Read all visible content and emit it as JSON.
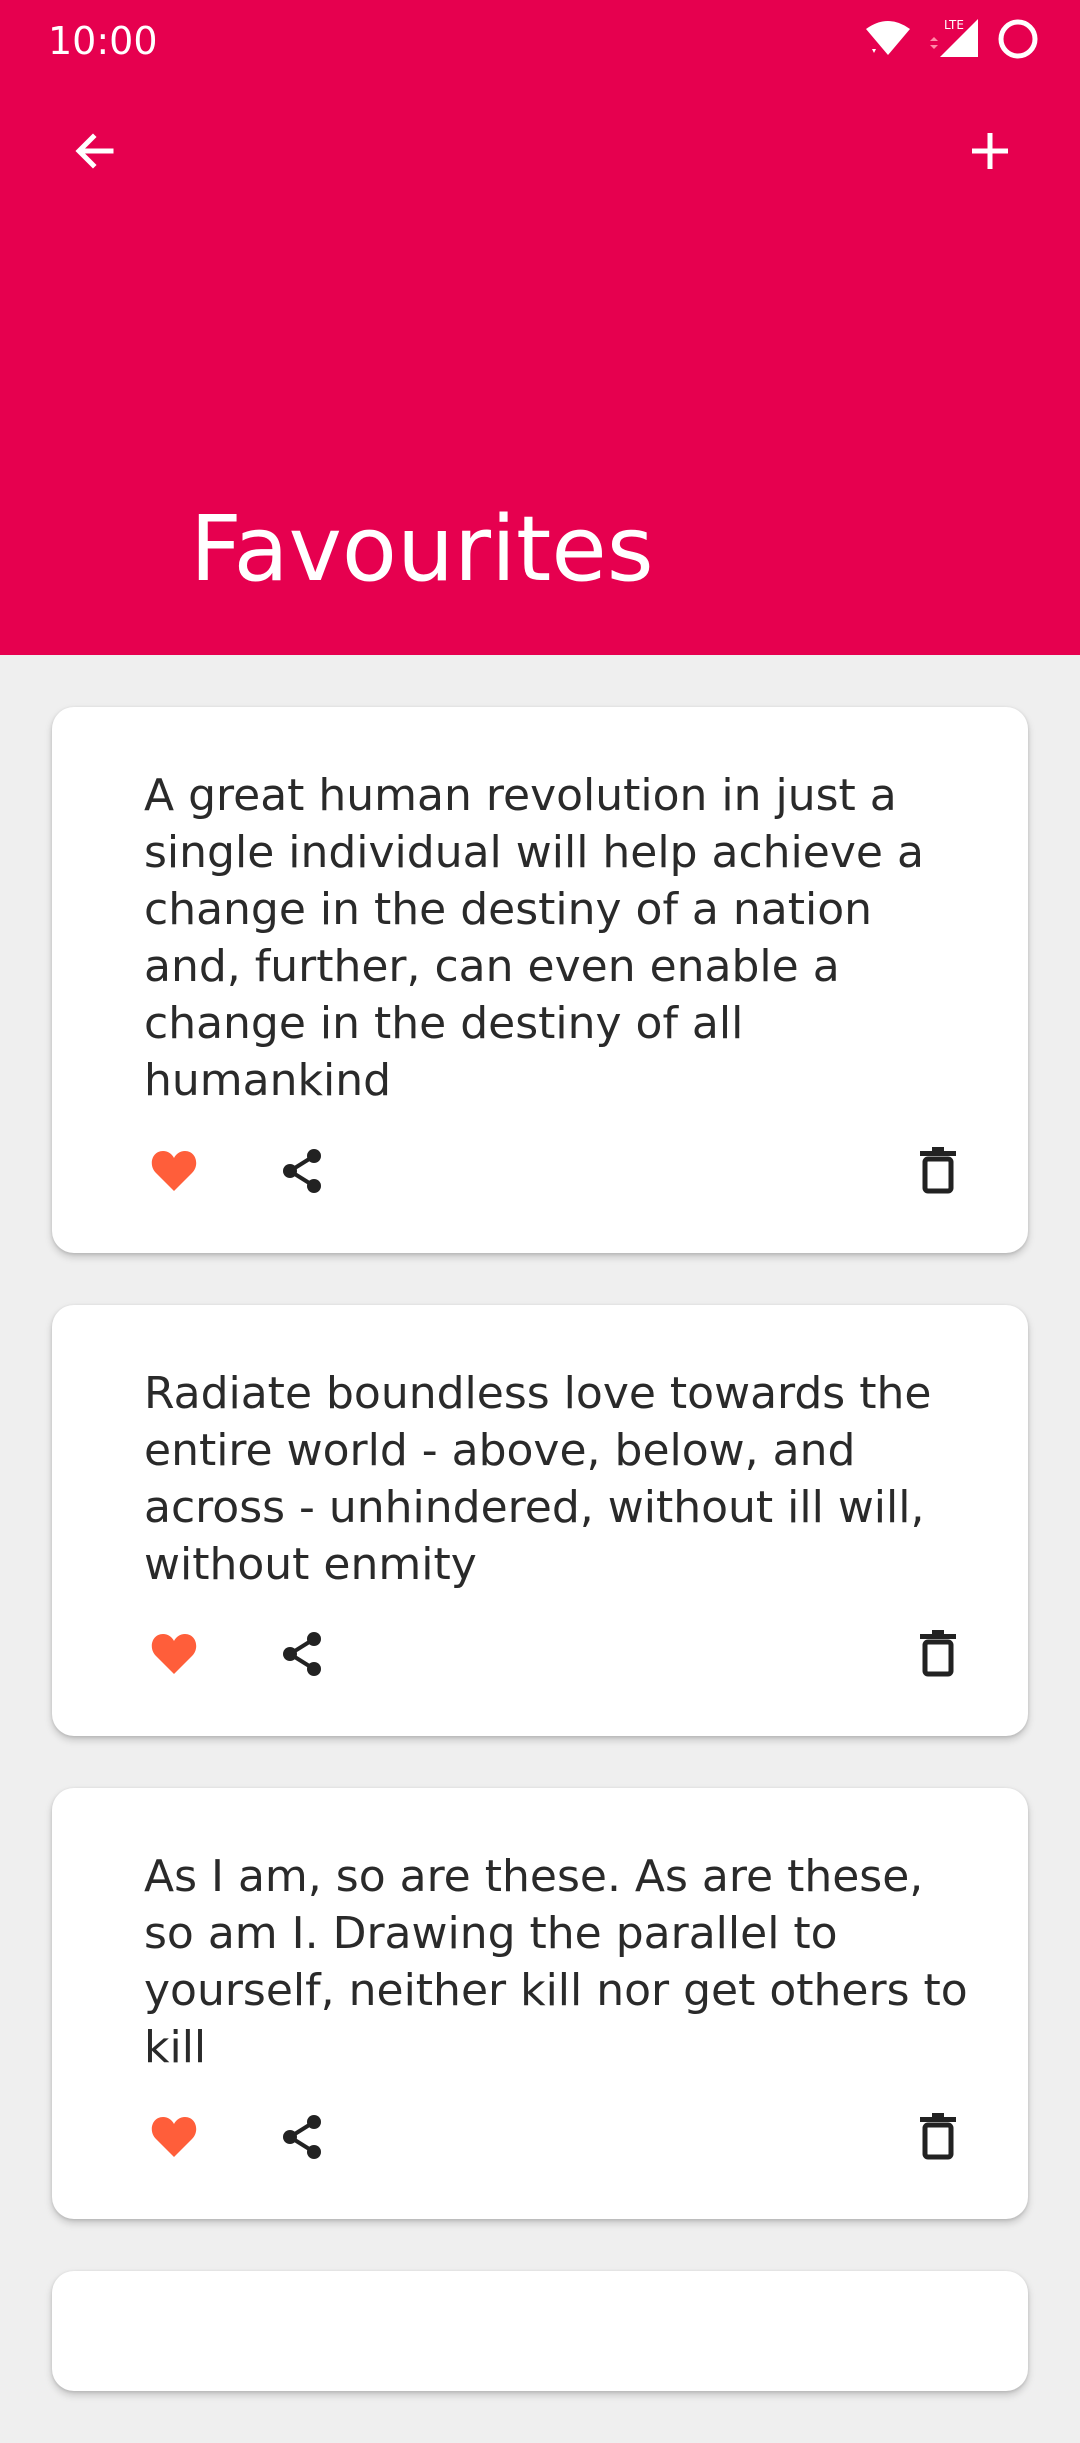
{
  "status_bar": {
    "time": "10:00",
    "network_label": "LTE"
  },
  "header": {
    "title": "Favourites"
  },
  "quotes": [
    {
      "text": "A great human revolution in just a single individual will help achieve a change in the destiny of a nation and, further, can even enable a change in the destiny of all humankind"
    },
    {
      "text": "Radiate boundless love towards the entire world - above, below, and across - unhindered, without ill will, without enmity"
    },
    {
      "text": "As I am, so are these. As are these, so am I. Drawing the parallel to yourself, neither kill nor get others to kill"
    }
  ],
  "colors": {
    "primary": "#e6004f",
    "background": "#efefef",
    "favorite": "#ff5e3a",
    "icon": "#222222"
  },
  "icons": {
    "back": "arrow-back-icon",
    "add": "plus-icon",
    "favorite": "heart-icon",
    "share": "share-icon",
    "delete": "trash-icon"
  }
}
